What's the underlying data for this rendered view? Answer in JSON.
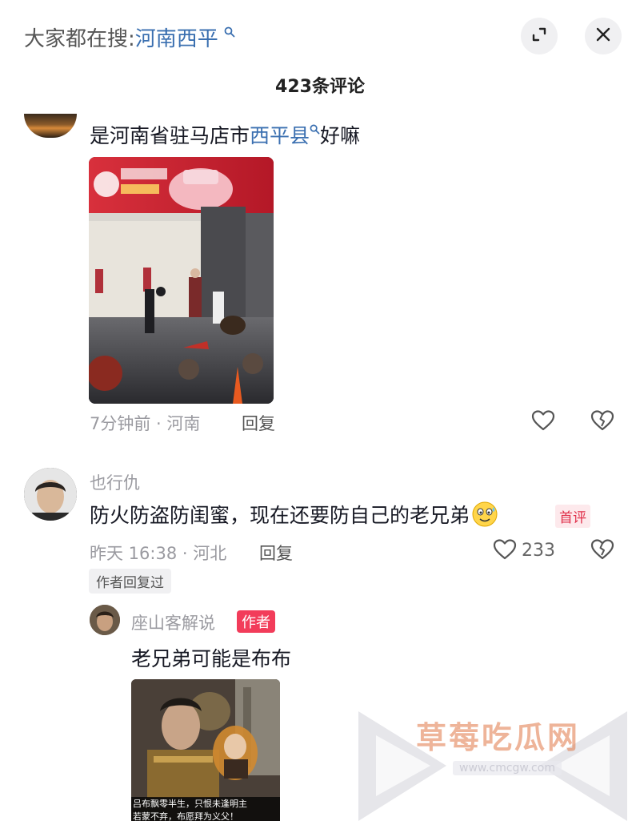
{
  "header": {
    "search_prefix": "大家都在搜:",
    "search_keyword": "河南西平",
    "search_icon": "search-icon",
    "expand_icon": "expand-icon",
    "close_icon": "close-icon"
  },
  "comments_count_label": "423条评论",
  "comments": [
    {
      "text_before": "是河南省驻马店市",
      "keyword": "西平县",
      "text_after": "好嘛",
      "time_location": "7分钟前 · 河南",
      "reply_label": "回复",
      "image_description_icon": "photo-image"
    },
    {
      "username": "也行仇",
      "text": "防火防盗防闺蜜，现在还要防自己的老兄弟",
      "emoji": "sweat-smile-emoji",
      "first_badge": "首评",
      "time_location": "昨天 16:38 · 河北",
      "reply_label": "回复",
      "like_count": "233",
      "author_replied_tag": "作者回复过"
    }
  ],
  "reply": {
    "username": "座山客解说",
    "author_badge": "作者",
    "text": "老兄弟可能是布布",
    "caption_line1": "吕布飘零半生，只恨未逢明主",
    "caption_line2": "若蒙不弃，布愿拜为义父！"
  },
  "watermark": {
    "title": "草莓吃瓜网",
    "url": "www.cmcgw.com"
  },
  "colors": {
    "keyword_blue": "#3a6fb0",
    "badge_red": "#f23c5a",
    "meta_gray": "#9a9aa0"
  }
}
